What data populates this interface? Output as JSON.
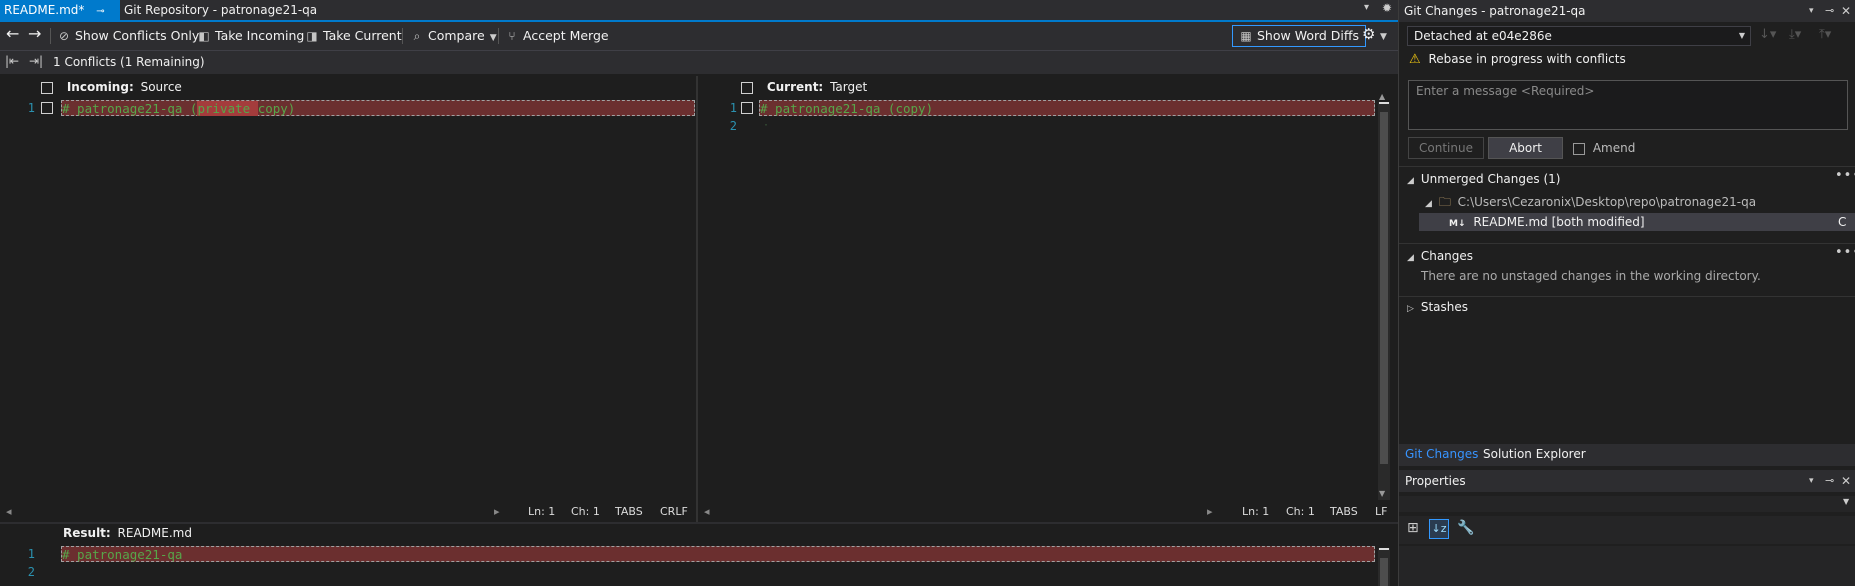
{
  "tabs": [
    {
      "label": "README.md*"
    },
    {
      "label": "Git Repository - patronage21-qa"
    }
  ],
  "toolbar": {
    "show_conflicts_only": "Show Conflicts Only",
    "take_incoming": "Take Incoming",
    "take_current": "Take Current",
    "compare": "Compare",
    "accept_merge": "Accept Merge",
    "show_word_diffs": "Show Word Diffs"
  },
  "nav": {
    "conflicts_text": "1 Conflicts (1 Remaining)"
  },
  "incoming": {
    "label": "Incoming:",
    "name": "Source",
    "line1_num": "1",
    "line1_pre": "# patronage21-qa (",
    "line1_hl": "private ",
    "line1_post": "copy)",
    "status": {
      "ln": "Ln: 1",
      "ch": "Ch: 1",
      "tabs": "TABS",
      "eol": "CRLF"
    }
  },
  "current": {
    "label": "Current:",
    "name": "Target",
    "line1_num": "1",
    "line2_num": "2",
    "line1": "# patronage21-qa (copy)",
    "status": {
      "ln": "Ln: 1",
      "ch": "Ch: 1",
      "tabs": "TABS",
      "eol": "LF"
    }
  },
  "result": {
    "label": "Result:",
    "name": "README.md",
    "line1_num": "1",
    "line2_num": "2",
    "line1": "# patronage21-qa"
  },
  "git_changes": {
    "title": "Git Changes - patronage21-qa",
    "branch": "Detached at e04e286e",
    "warning": "Rebase in progress with conflicts",
    "message_placeholder": "Enter a message <Required>",
    "continue": "Continue",
    "abort": "Abort",
    "amend": "Amend",
    "unmerged_header": "Unmerged Changes (1)",
    "unmerged_path": "C:\\Users\\Cezaronix\\Desktop\\repo\\patronage21-qa",
    "unmerged_file": "README.md [both modified]",
    "unmerged_file_status": "C",
    "changes_header": "Changes",
    "changes_empty": "There are no unstaged changes in the working directory.",
    "stashes_header": "Stashes"
  },
  "bottom_tabs": [
    {
      "label": "Git Changes"
    },
    {
      "label": "Solution Explorer"
    }
  ],
  "properties": {
    "title": "Properties"
  },
  "colors": {
    "accent": "#007acc",
    "conflict_bg": "#6b2f2f",
    "code_green": "#57a64a",
    "line_number": "#2b91af"
  }
}
